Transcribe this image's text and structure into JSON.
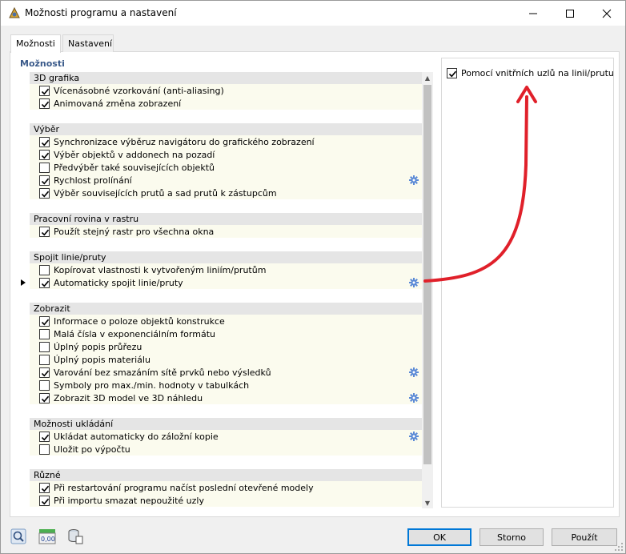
{
  "window": {
    "title": "Možnosti programu a nastavení"
  },
  "tabs": [
    {
      "label": "Možnosti",
      "active": true
    },
    {
      "label": "Nastavení",
      "active": false
    }
  ],
  "group_header": "Možnosti",
  "sections": [
    {
      "title": "3D grafika",
      "items": [
        {
          "label": "Vícenásobné vzorkování (anti-aliasing)",
          "checked": true,
          "gear": false
        },
        {
          "label": "Animovaná změna zobrazení",
          "checked": true,
          "gear": false
        }
      ]
    },
    {
      "title": "Výběr",
      "items": [
        {
          "label": "Synchronizace výběruz navigátoru do grafického zobrazení",
          "checked": true,
          "gear": false
        },
        {
          "label": "Výběr objektů v addonech na pozadí",
          "checked": true,
          "gear": false
        },
        {
          "label": "Předvýběr také souvisejících objektů",
          "checked": false,
          "gear": false
        },
        {
          "label": "Rychlost prolínání",
          "checked": true,
          "gear": true
        },
        {
          "label": "Výběr souvisejících prutů a sad prutů k zástupcům",
          "checked": true,
          "gear": false
        }
      ]
    },
    {
      "title": "Pracovní rovina v rastru",
      "items": [
        {
          "label": "Použít stejný rastr pro všechna okna",
          "checked": true,
          "gear": false
        }
      ]
    },
    {
      "title": "Spojit linie/pruty",
      "items": [
        {
          "label": "Kopírovat vlastnosti k vytvořeným liniím/prutům",
          "checked": false,
          "gear": false
        },
        {
          "label": "Automaticky spojit linie/pruty",
          "checked": true,
          "gear": true
        }
      ]
    },
    {
      "title": "Zobrazit",
      "items": [
        {
          "label": "Informace o poloze objektů konstrukce",
          "checked": true,
          "gear": false
        },
        {
          "label": "Malá čísla v exponenciálním formátu",
          "checked": false,
          "gear": false
        },
        {
          "label": "Úplný popis průřezu",
          "checked": false,
          "gear": false
        },
        {
          "label": "Úplný popis materiálu",
          "checked": false,
          "gear": false
        },
        {
          "label": "Varování bez smazáním sítě prvků nebo výsledků",
          "checked": true,
          "gear": true
        },
        {
          "label": "Symboly pro max./min. hodnoty v tabulkách",
          "checked": false,
          "gear": false
        },
        {
          "label": "Zobrazit 3D model ve 3D náhledu",
          "checked": true,
          "gear": true
        }
      ]
    },
    {
      "title": "Možnosti ukládání",
      "items": [
        {
          "label": "Ukládat automaticky do záložní kopie",
          "checked": true,
          "gear": true
        },
        {
          "label": "Uložit po výpočtu",
          "checked": false,
          "gear": false
        }
      ]
    },
    {
      "title": "Různé",
      "items": [
        {
          "label": "Při restartování programu načíst poslední otevřené modely",
          "checked": true,
          "gear": false
        },
        {
          "label": "Při importu smazat nepoužité uzly",
          "checked": true,
          "gear": false
        }
      ]
    }
  ],
  "right_panel": {
    "label": "Pomocí vnitřních uzlů na linii/prutu",
    "checked": true
  },
  "buttons": {
    "ok": "OK",
    "cancel": "Storno",
    "apply": "Použít"
  },
  "bottom_icons": {
    "units_text": "0,00"
  },
  "colors": {
    "accent": "#0078d7",
    "annotation_arrow": "#e0202a",
    "gear": "#5b8ad6",
    "section_header": "#e5e5e5",
    "section_body": "#fbfbee"
  }
}
